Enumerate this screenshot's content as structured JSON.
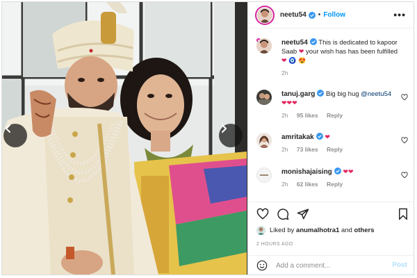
{
  "post": {
    "author": "neetu54",
    "follow_label": "Follow",
    "dot": "•",
    "more_label": "•••"
  },
  "caption": {
    "username": "neetu54",
    "text": "This is dedicated to kapoor Saab",
    "text_2": "your wish has has been fulfilled",
    "age": "2h"
  },
  "comments": [
    {
      "username": "tanuj.garg",
      "text": "Big big hug",
      "mention": "@neetu54",
      "age": "2h",
      "likes": "95 likes",
      "reply": "Reply"
    },
    {
      "username": "amritakak",
      "text": "",
      "age": "2h",
      "likes": "73 likes",
      "reply": "Reply"
    },
    {
      "username": "monishajaising",
      "text": "",
      "age": "2h",
      "likes": "62 likes",
      "reply": "Reply"
    }
  ],
  "liked_by": {
    "prefix": "Liked by",
    "user": "anumalhotra1",
    "connector": "and",
    "others": "others"
  },
  "timestamp": "2 HOURS AGO",
  "add_comment": {
    "placeholder": "Add a comment...",
    "post_label": "Post"
  },
  "icons": {
    "verified": "verified-badge-icon",
    "heart": "heart-icon",
    "comment": "comment-icon",
    "share": "paper-plane-icon",
    "save": "bookmark-icon",
    "emoji": "smiley-icon",
    "prev": "chevron-left-icon",
    "next": "chevron-right-icon"
  },
  "colors": {
    "accent": "#0095f6",
    "heart_red": "#ed4956",
    "verified_blue": "#3897f0",
    "muted": "#8e8e8e"
  }
}
